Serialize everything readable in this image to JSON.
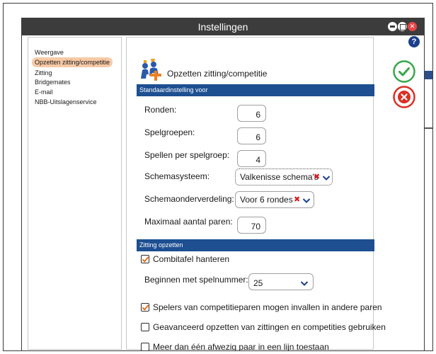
{
  "window": {
    "title": "Instellingen"
  },
  "sidebar": {
    "items": [
      {
        "label": "Weergave",
        "active": false
      },
      {
        "label": "Opzetten zitting/competitie",
        "active": true
      },
      {
        "label": "Zitting",
        "active": false
      },
      {
        "label": "Bridgemates",
        "active": false
      },
      {
        "label": "E-mail",
        "active": false
      },
      {
        "label": "NBB-Uitslagenservice",
        "active": false
      }
    ]
  },
  "panel": {
    "icon": "team-pairs-icon",
    "title": "Opzetten zitting/competitie",
    "section1": "Standaardinstelling voor",
    "fields": {
      "rounds": {
        "label": "Ronden:",
        "value": "6"
      },
      "groups": {
        "label": "Spelgroepen:",
        "value": "6"
      },
      "boards_per_group": {
        "label": "Spellen per spelgroep:",
        "value": "4"
      },
      "scheme_system": {
        "label": "Schemasysteem:",
        "value": "Valkenisse schema's"
      },
      "scheme_subdivision": {
        "label": "Schemaonderverdeling:",
        "value": "Voor 6 rondes"
      },
      "max_pairs": {
        "label": "Maximaal aantal paren:",
        "value": "70"
      }
    },
    "section2": "Zitting opzetten",
    "combitable": {
      "label": "Combitafel hanteren",
      "checked": true
    },
    "start_board": {
      "label": "Beginnen met spelnummer:",
      "value": "25"
    },
    "options": [
      {
        "label": "Spelers van competitieparen mogen invallen in andere paren",
        "checked": true
      },
      {
        "label": "Geavanceerd opzetten van zittingen en competities gebruiken",
        "checked": false
      },
      {
        "label": "Meer dan één afwezig paar in een lijn toestaan",
        "checked": false
      }
    ]
  },
  "actions": {
    "help": "?",
    "ok_icon": "check-icon",
    "cancel_icon": "close-icon"
  },
  "colors": {
    "title_bar": "#3c3c3c",
    "section_bar": "#1d4f91",
    "active_item": "#f7c9a6",
    "ok": "#3aa64a",
    "cancel": "#d93025",
    "checkmark": "#e07020"
  }
}
